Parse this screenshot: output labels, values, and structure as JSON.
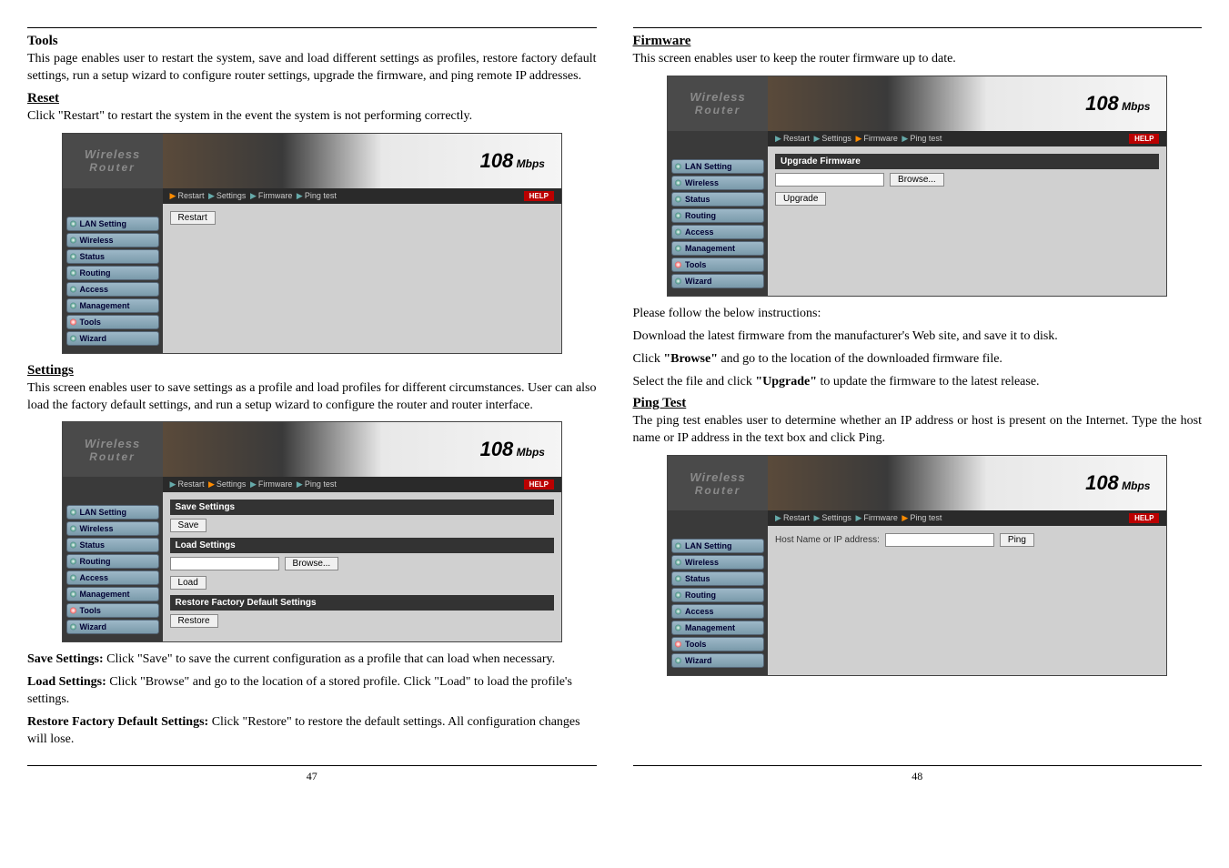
{
  "left": {
    "tools_heading": "Tools",
    "tools_body": "This page enables user to restart the system, save and load different settings as profiles, restore factory default settings, run a setup wizard to configure router settings, upgrade the firmware, and ping remote IP addresses.",
    "reset_heading": "Reset",
    "reset_body": "Click \"Restart\" to restart the system in the event the system is not performing correctly.",
    "settings_heading": "Settings",
    "settings_body": "This screen enables user to save settings as a profile and load profiles for different circumstances. User can also load the factory default settings, and run a setup wizard to configure the router and router interface.",
    "save_label": "Save Settings:",
    "save_text": " Click \"Save\" to save the current configuration as a profile that can load when necessary.",
    "load_label": "Load Settings:",
    "load_text": " Click \"Browse\" and go to the location of a stored profile. Click \"Load\" to load the profile's settings.",
    "restore_label": "Restore Factory Default Settings:",
    "restore_text": " Click \"Restore\" to restore the default settings. All configuration changes will lose.",
    "page_num": "47"
  },
  "right": {
    "firmware_heading": "Firmware",
    "firmware_body": "This screen enables user to keep the router firmware up to date.",
    "instructions_intro": "Please follow the below instructions:",
    "instruction1": "Download the latest firmware from the manufacturer's Web site, and save it to disk.",
    "instruction2a": "Click ",
    "instruction2b": "\"Browse\"",
    "instruction2c": " and go to the location of the downloaded firmware file.",
    "instruction3a": "Select the file and click ",
    "instruction3b": "\"Upgrade\"",
    "instruction3c": " to update the firmware to the latest release.",
    "ping_heading": "Ping Test",
    "ping_body": "The ping test enables user to determine whether an IP address or host is present on the Internet. Type the host name or IP address in the text box and click Ping.",
    "page_num": "48"
  },
  "router": {
    "logo_line1": "Wireless",
    "logo_line2": "Router",
    "banner_main": "108",
    "banner_sub": " Mbps",
    "crumb_restart": "Restart",
    "crumb_settings": "Settings",
    "crumb_firmware": "Firmware",
    "crumb_ping": "Ping test",
    "help": "HELP",
    "nav": {
      "lan": "LAN Setting",
      "wireless": "Wireless",
      "status": "Status",
      "routing": "Routing",
      "access": "Access",
      "management": "Management",
      "tools": "Tools",
      "wizard": "Wizard"
    },
    "restart_btn": "Restart",
    "save_panel": "Save Settings",
    "save_btn": "Save",
    "load_panel": "Load Settings",
    "browse_btn": "Browse...",
    "load_btn": "Load",
    "restore_panel": "Restore Factory Default Settings",
    "restore_btn": "Restore",
    "upgrade_panel": "Upgrade Firmware",
    "upgrade_btn": "Upgrade",
    "ping_label": "Host Name or IP address:",
    "ping_btn": "Ping"
  }
}
